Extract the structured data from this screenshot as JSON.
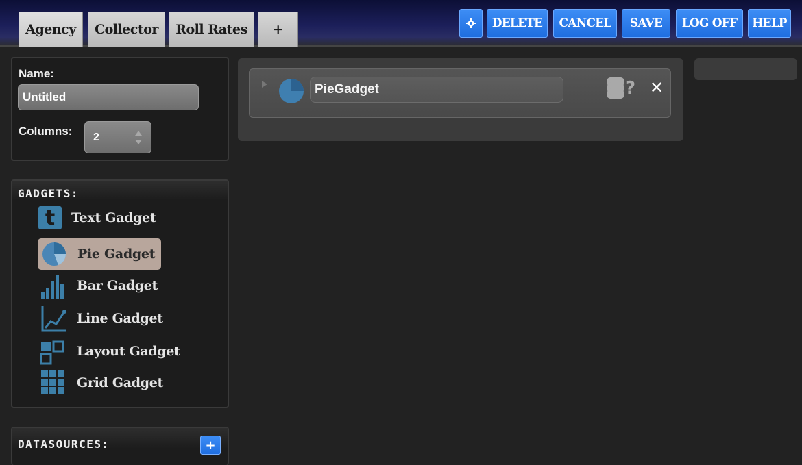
{
  "tabs": [
    {
      "label": "Agency"
    },
    {
      "label": "Collector"
    },
    {
      "label": "Roll Rates"
    },
    {
      "label": "+"
    }
  ],
  "toolbar": {
    "settings_icon": "gear-icon",
    "delete_label": "DELETE",
    "cancel_label": "CANCEL",
    "save_label": "SAVE",
    "logoff_label": "LOG OFF",
    "help_label": "HELP",
    "accent_color": "#2a7ef0"
  },
  "props": {
    "name_label": "Name:",
    "name_value": "Untitled",
    "columns_label": "Columns:",
    "columns_value": "2"
  },
  "gadgets": {
    "heading": "GADGETS:",
    "items": [
      {
        "label": "Text Gadget",
        "icon": "text-t-icon"
      },
      {
        "label": "Pie Gadget",
        "icon": "pie-chart-icon",
        "selected": true
      },
      {
        "label": "Bar Gadget",
        "icon": "bar-chart-icon"
      },
      {
        "label": "Line Gadget",
        "icon": "line-chart-icon"
      },
      {
        "label": "Layout Gadget",
        "icon": "layout-icon"
      },
      {
        "label": "Grid Gadget",
        "icon": "grid-icon"
      }
    ]
  },
  "datasources": {
    "heading": "DATASOURCES:",
    "add_label": "+"
  },
  "canvas": {
    "gadget_title": "PieGadget",
    "help_glyph": "?",
    "close_glyph": "✕"
  }
}
